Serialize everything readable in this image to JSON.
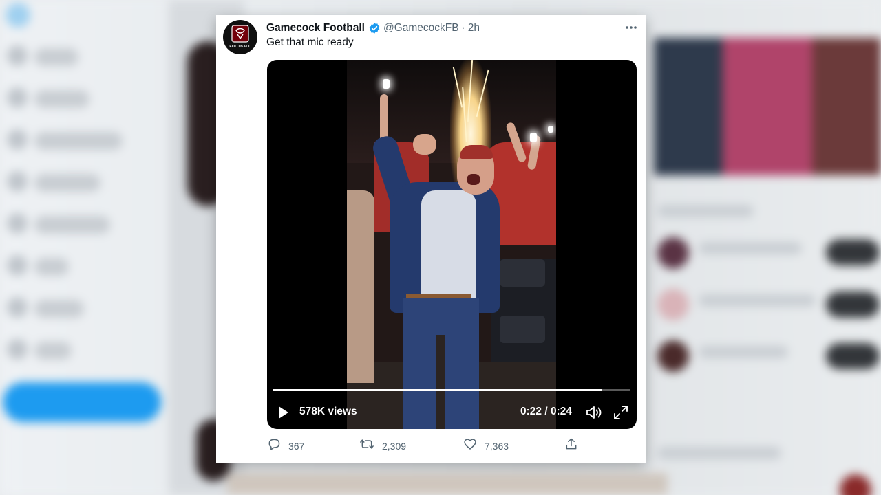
{
  "tweet": {
    "author": {
      "display_name": "Gamecock Football",
      "handle": "@GamecockFB",
      "avatar_label": "FOOTBALL"
    },
    "separator": "·",
    "time": "2h",
    "text": "Get that mic ready",
    "video": {
      "views": "578K views",
      "time_readout": "0:22 / 0:24",
      "progress": 0.92
    },
    "actions": {
      "replies": "367",
      "retweets": "2,309",
      "likes": "7,363"
    }
  },
  "colors": {
    "verified": "#1d9bf0",
    "text_primary": "#0f1419",
    "text_secondary": "#536471",
    "brand_garnet": "#73000a"
  },
  "icons": [
    "verified-icon",
    "more-icon",
    "play-icon",
    "volume-icon",
    "fullscreen-icon",
    "reply-icon",
    "retweet-icon",
    "like-icon",
    "share-icon"
  ]
}
